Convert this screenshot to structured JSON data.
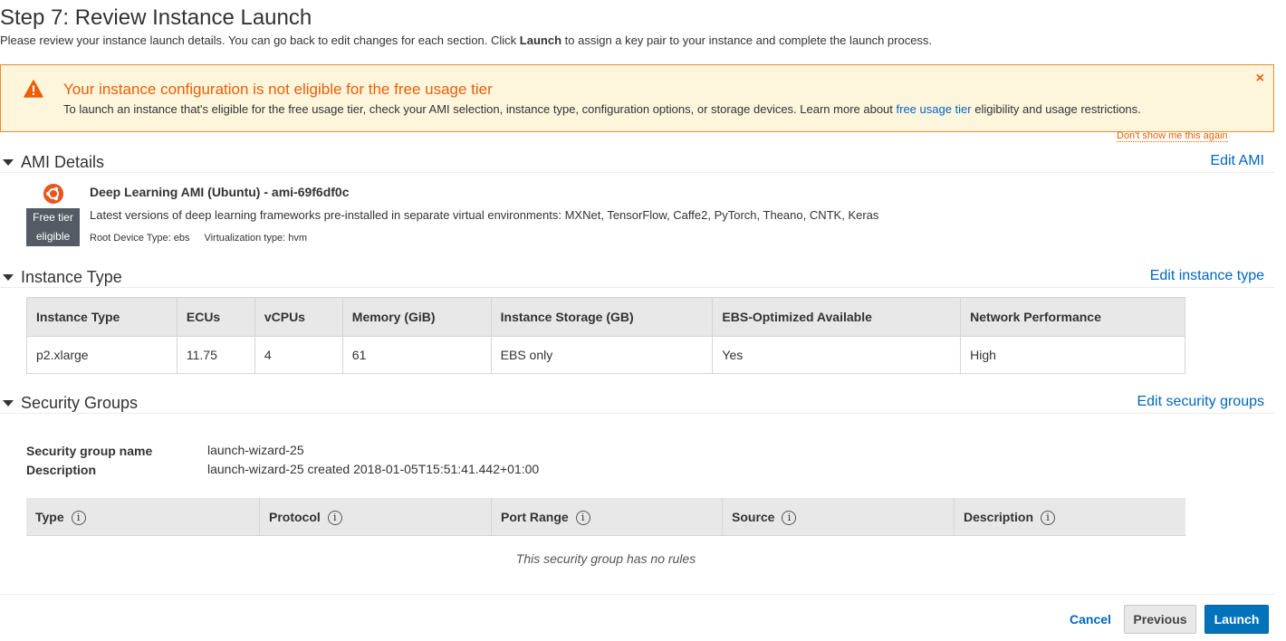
{
  "page": {
    "title": "Step 7: Review Instance Launch",
    "intro_before": "Please review your instance launch details. You can go back to edit changes for each section. Click ",
    "intro_bold": "Launch",
    "intro_after": " to assign a key pair to your instance and complete the launch process."
  },
  "warning": {
    "icon": "warning-triangle-icon",
    "title": "Your instance configuration is not eligible for the free usage tier",
    "body_before": "To launch an instance that's eligible for the free usage tier, check your AMI selection, instance type, configuration options, or storage devices. Learn more about ",
    "link": "free usage tier",
    "body_after": " eligibility and usage restrictions.",
    "close": "×",
    "dont_show": "Don't show me this again"
  },
  "ami_section": {
    "title": "AMI Details",
    "edit": "Edit AMI",
    "name": "Deep Learning AMI (Ubuntu) - ami-69f6df0c",
    "free_tier_line1": "Free tier",
    "free_tier_line2": "eligible",
    "description": "Latest versions of deep learning frameworks pre-installed in separate virtual environments: MXNet, TensorFlow, Caffe2, PyTorch, Theano, CNTK, Keras",
    "root_device": "Root Device Type: ebs",
    "virtualization": "Virtualization type: hvm"
  },
  "instance_section": {
    "title": "Instance Type",
    "edit": "Edit instance type",
    "headers": [
      "Instance Type",
      "ECUs",
      "vCPUs",
      "Memory (GiB)",
      "Instance Storage (GB)",
      "EBS-Optimized Available",
      "Network Performance"
    ],
    "row": [
      "p2.xlarge",
      "11.75",
      "4",
      "61",
      "EBS only",
      "Yes",
      "High"
    ]
  },
  "security_section": {
    "title": "Security Groups",
    "edit": "Edit security groups",
    "name_label": "Security group name",
    "name_value": "launch-wizard-25",
    "desc_label": "Description",
    "desc_value": "launch-wizard-25 created 2018-01-05T15:51:41.442+01:00",
    "rule_headers": [
      "Type",
      "Protocol",
      "Port Range",
      "Source",
      "Description"
    ],
    "info_glyph": "i",
    "no_rules": "This security group has no rules"
  },
  "footer": {
    "cancel": "Cancel",
    "previous": "Previous",
    "launch": "Launch"
  },
  "colors": {
    "link": "#0066c0",
    "warning_accent": "#eb5f07",
    "warning_bg": "#fef5dd",
    "primary_button": "#0073bb"
  }
}
